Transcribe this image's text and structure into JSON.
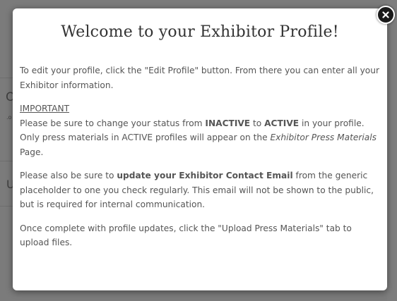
{
  "background_fragments": {
    "frag_1": "OI",
    "frag_2": ".o",
    "frag_3": "U"
  },
  "modal": {
    "title": "Welcome to your Exhibitor Profile!",
    "paragraphs": {
      "intro": "To edit your profile, click the \"Edit Profile\" button. From there you can enter all your Exhibitor information.",
      "important_heading": "IMPORTANT",
      "important_pre": "Please be sure to change your status from ",
      "important_inactive": "INACTIVE",
      "important_to": " to ",
      "important_active": "ACTIVE",
      "important_mid": " in your profile. Only press materials in ACTIVE profiles will appear on the ",
      "important_page": "Exhibitor Press Materials",
      "important_end": " Page.",
      "email_pre": "Please also be sure to ",
      "email_bold": "update your Exhibitor Contact Email",
      "email_post": " from the generic placeholder to one you check regularly. This email will not be shown to the public, but is required for internal communication.",
      "upload": "Once complete with profile updates, click the \"Upload Press Materials\" tab to upload files."
    },
    "close_icon": "close-icon"
  },
  "colors": {
    "overlay": "#7a7a7a",
    "modal_bg": "#ffffff",
    "text": "#555555",
    "title": "#333333",
    "close_bg": "#1a1a1a"
  }
}
